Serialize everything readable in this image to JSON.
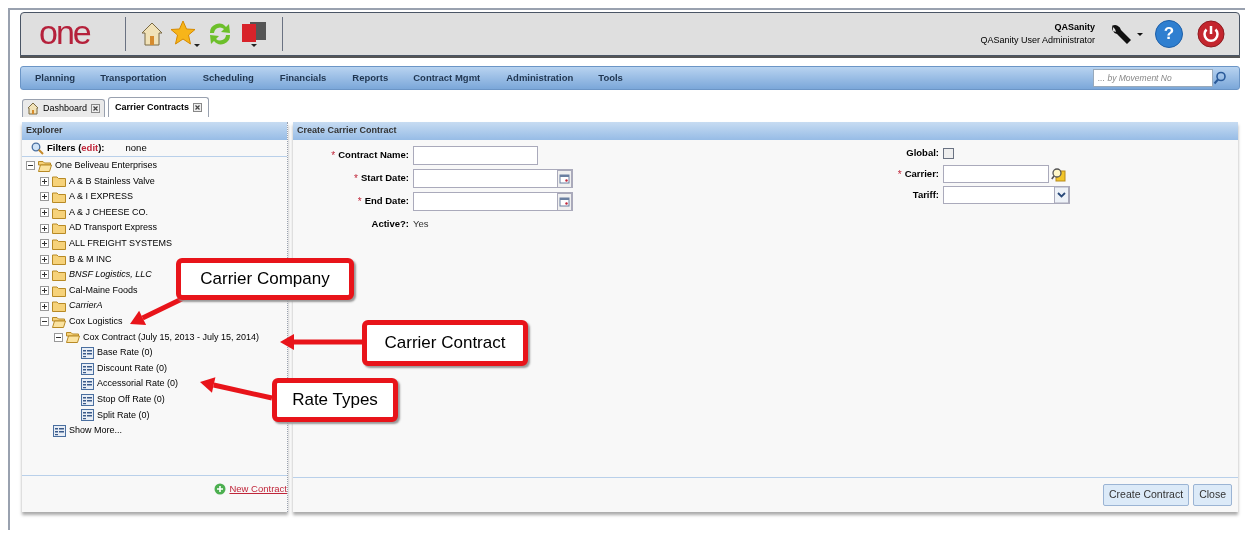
{
  "header": {
    "logo": "one",
    "help": "?",
    "user_name": "QASanity",
    "user_role": "QASanity User Administrator"
  },
  "nav": {
    "menus": [
      "Planning",
      "Transportation",
      "Scheduling",
      "Financials",
      "Reports",
      "Contract Mgmt",
      "Administration",
      "Tools"
    ],
    "search": {
      "placeholder": "... by Movement No"
    }
  },
  "tabs": [
    {
      "label": "Dashboard",
      "selected": false,
      "kind": "home"
    },
    {
      "label": "Carrier Contracts",
      "selected": true,
      "kind": "plain"
    }
  ],
  "explorer": {
    "title": "Explorer",
    "filters_label": "Filters (",
    "filters_link": "edit",
    "filters_suffix": "):",
    "filters_value": "none",
    "tree": [
      {
        "label": "One Beliveau Enterprises",
        "kind": "folder",
        "expanded": true,
        "italic": false,
        "children": [
          {
            "label": "A & B Stainless Valve",
            "kind": "folder",
            "expanded": false,
            "italic": false
          },
          {
            "label": "A & I EXPRESS",
            "kind": "folder",
            "expanded": false,
            "italic": false
          },
          {
            "label": "A & J CHEESE CO.",
            "kind": "folder",
            "expanded": false,
            "italic": false
          },
          {
            "label": "AD Transport Express",
            "kind": "folder",
            "expanded": false,
            "italic": false
          },
          {
            "label": "ALL FREIGHT SYSTEMS",
            "kind": "folder",
            "expanded": false,
            "italic": false
          },
          {
            "label": "B & M INC",
            "kind": "folder",
            "expanded": false,
            "italic": false
          },
          {
            "label": "BNSF Logistics, LLC",
            "kind": "folder",
            "expanded": false,
            "italic": true
          },
          {
            "label": "Cal-Maine Foods",
            "kind": "folder",
            "expanded": false,
            "italic": false
          },
          {
            "label": "CarrierA",
            "kind": "folder",
            "expanded": false,
            "italic": true
          },
          {
            "label": "Cox Logistics",
            "kind": "folder",
            "expanded": true,
            "italic": false,
            "children": [
              {
                "label": "Cox Contract (July 15, 2013 - July 15, 2014)",
                "kind": "folder",
                "expanded": true,
                "italic": false,
                "children": [
                  {
                    "label": "Base Rate (0)",
                    "kind": "rate",
                    "italic": false
                  },
                  {
                    "label": "Discount Rate (0)",
                    "kind": "rate",
                    "italic": false
                  },
                  {
                    "label": "Accessorial Rate (0)",
                    "kind": "rate",
                    "italic": false
                  },
                  {
                    "label": "Stop Off Rate (0)",
                    "kind": "rate",
                    "italic": false
                  },
                  {
                    "label": "Split Rate (0)",
                    "kind": "rate",
                    "italic": false
                  }
                ]
              }
            ]
          },
          {
            "label": "Show More...",
            "kind": "rate",
            "italic": false
          }
        ]
      }
    ],
    "new_link": "New Contract"
  },
  "form": {
    "title": "Create Carrier Contract",
    "required_mark": "*",
    "left_fields": [
      {
        "label": "Contract Name:",
        "required": true,
        "kind": "text"
      },
      {
        "label": "Start Date:",
        "required": true,
        "kind": "date"
      },
      {
        "label": "End Date:",
        "required": true,
        "kind": "date"
      },
      {
        "label": "Active?:",
        "required": false,
        "kind": "readonly",
        "value": "Yes"
      }
    ],
    "right_fields": [
      {
        "label": "Global:",
        "required": false,
        "kind": "checkbox",
        "checked": false
      },
      {
        "label": "Carrier:",
        "required": true,
        "kind": "lookup"
      },
      {
        "label": "Tariff:",
        "required": false,
        "kind": "select"
      }
    ],
    "buttons": [
      "Create Contract",
      "Close"
    ]
  },
  "annotations": [
    "Carrier Company",
    "Carrier Contract",
    "Rate Types"
  ]
}
